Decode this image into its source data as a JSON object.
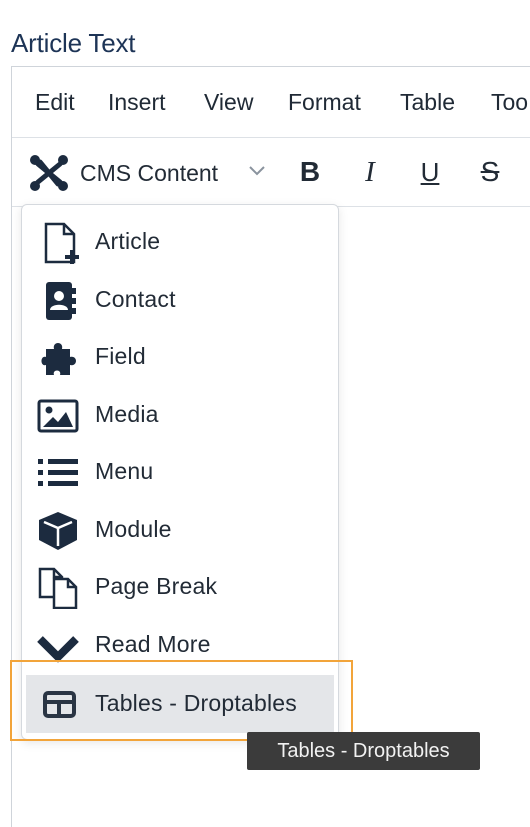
{
  "field": {
    "label": "Article Text"
  },
  "menubar": {
    "items": [
      "Edit",
      "Insert",
      "View",
      "Format",
      "Table",
      "Too"
    ]
  },
  "toolbar": {
    "cms_label": "CMS Content",
    "bold": "B",
    "italic": "I",
    "underline": "U",
    "strikethrough": "S"
  },
  "dropdown": {
    "items": [
      {
        "label": "Article",
        "icon": "file-plus-icon"
      },
      {
        "label": "Contact",
        "icon": "contact-book-icon"
      },
      {
        "label": "Field",
        "icon": "puzzle-piece-icon"
      },
      {
        "label": "Media",
        "icon": "image-icon"
      },
      {
        "label": "Menu",
        "icon": "list-icon"
      },
      {
        "label": "Module",
        "icon": "cube-icon"
      },
      {
        "label": "Page Break",
        "icon": "copy-pages-icon"
      },
      {
        "label": "Read More",
        "icon": "chevron-down-icon"
      },
      {
        "label": "Tables - Droptables",
        "icon": "table-icon",
        "active": true
      }
    ]
  },
  "tooltip": {
    "text": "Tables - Droptables"
  },
  "colors": {
    "highlight": "#f2a43a",
    "text_dark": "#1d3456",
    "icon": "#1c2b3f"
  }
}
